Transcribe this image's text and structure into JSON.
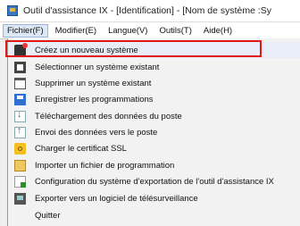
{
  "window": {
    "title": "Outil d'assistance IX - [Identification] - [Nom de système :Sy"
  },
  "menubar": [
    {
      "label": "Fichier(F)"
    },
    {
      "label": "Modifier(E)"
    },
    {
      "label": "Langue(V)"
    },
    {
      "label": "Outils(T)"
    },
    {
      "label": "Aide(H)"
    }
  ],
  "file_menu": {
    "items": [
      {
        "label": "Créez un nouveau système",
        "icon": "new-system-icon",
        "selected": true
      },
      {
        "label": "Sélectionner un système existant",
        "icon": "select-system-icon"
      },
      {
        "label": "Supprimer un système existant",
        "icon": "trash-icon"
      },
      {
        "label": "Enregistrer les programmations",
        "icon": "save-icon"
      },
      {
        "label": "Téléchargement des données du poste",
        "icon": "download-icon"
      },
      {
        "label": "Envoi des données vers le poste",
        "icon": "upload-icon"
      },
      {
        "label": "Charger le certificat SSL",
        "icon": "certificate-icon"
      },
      {
        "label": "Importer un fichier de programmation",
        "icon": "import-file-icon"
      },
      {
        "label": "Configuration du système d'exportation de l'outil d'assistance IX",
        "icon": "export-config-icon"
      },
      {
        "label": "Exporter vers un logiciel de télésurveillance",
        "icon": "export-icon"
      },
      {
        "label": "Quitter",
        "icon": ""
      }
    ]
  },
  "highlight_color": "#e01818"
}
